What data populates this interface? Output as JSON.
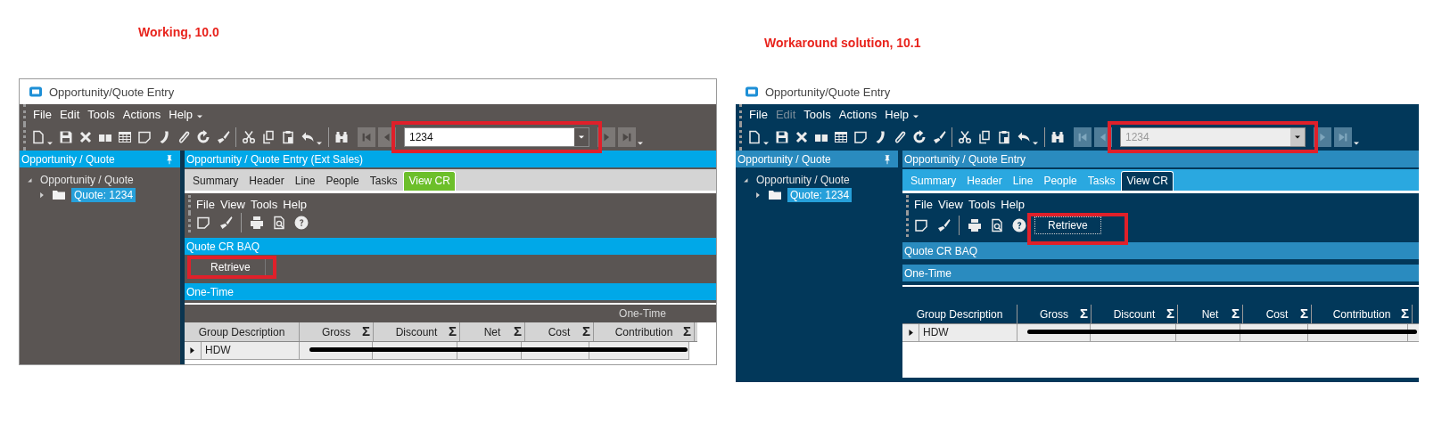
{
  "windows": [
    {
      "caption": "Working, 10.0",
      "kind": "dark",
      "title": "Opportunity/Quote Entry",
      "menu": [
        {
          "label": "File",
          "disabled": false
        },
        {
          "label": "Edit",
          "disabled": false
        },
        {
          "label": "Tools",
          "disabled": false
        },
        {
          "label": "Actions",
          "disabled": false
        },
        {
          "label": "Help",
          "disabled": false
        }
      ],
      "record": {
        "value": "1234",
        "disabled": false,
        "highlighted": true
      },
      "tree_panel": {
        "title": "Opportunity / Quote",
        "tree": [
          {
            "label": "Opportunity / Quote",
            "expanded": true,
            "selected": false,
            "children": [
              {
                "label": "Quote: 1234",
                "expanded": false,
                "selected": true
              }
            ]
          }
        ]
      },
      "detail_panel": {
        "title": "Opportunity / Quote Entry (Ext Sales)",
        "tabs": [
          {
            "label": "Summary",
            "selected": false
          },
          {
            "label": "Header",
            "selected": false
          },
          {
            "label": "Line",
            "selected": false
          },
          {
            "label": "People",
            "selected": false
          },
          {
            "label": "Tasks",
            "selected": false
          },
          {
            "label": "View CR",
            "selected": true
          }
        ],
        "menu": [
          "File",
          "View",
          "Tools",
          "Help"
        ],
        "blocks": [
          {
            "kind": "bar",
            "label": "Quote CR BAQ"
          },
          {
            "kind": "button_bar",
            "button": {
              "label": "Retrieve",
              "highlighted": true
            }
          },
          {
            "kind": "bar",
            "label": "One-Time"
          },
          {
            "kind": "band",
            "label": "One-Time"
          },
          {
            "kind": "grid",
            "columns": [
              {
                "label": "Group Description"
              },
              {
                "label": "Gross",
                "summary": "Σ"
              },
              {
                "label": "Discount",
                "summary": "Σ"
              },
              {
                "label": "Net",
                "summary": "Σ"
              },
              {
                "label": "Cost",
                "summary": "Σ"
              },
              {
                "label": "Contribution",
                "summary": "Σ"
              }
            ],
            "rows": [
              {
                "cells": [
                  "HDW"
                ],
                "redacted": true
              }
            ]
          }
        ]
      }
    },
    {
      "caption": "Workaround solution, 10.1",
      "kind": "navy",
      "title": "Opportunity/Quote Entry",
      "menu": [
        {
          "label": "File",
          "disabled": false
        },
        {
          "label": "Edit",
          "disabled": true
        },
        {
          "label": "Tools",
          "disabled": false
        },
        {
          "label": "Actions",
          "disabled": false
        },
        {
          "label": "Help",
          "disabled": false
        }
      ],
      "record": {
        "value": "1234",
        "disabled": true,
        "highlighted": true
      },
      "tree_panel": {
        "title": "Opportunity / Quote",
        "tree": [
          {
            "label": "Opportunity / Quote",
            "expanded": true,
            "selected": false,
            "children": [
              {
                "label": "Quote: 1234",
                "expanded": false,
                "selected": true
              }
            ]
          }
        ]
      },
      "detail_panel": {
        "title": "Opportunity / Quote Entry",
        "tabs": [
          {
            "label": "Summary",
            "selected": false
          },
          {
            "label": "Header",
            "selected": false
          },
          {
            "label": "Line",
            "selected": false
          },
          {
            "label": "People",
            "selected": false
          },
          {
            "label": "Tasks",
            "selected": false
          },
          {
            "label": "View CR",
            "selected": true
          }
        ],
        "menu": [
          "File",
          "View",
          "Tools",
          "Help"
        ],
        "toolbar_button": {
          "label": "Retrieve",
          "highlighted": true
        },
        "blocks": [
          {
            "kind": "bar",
            "label": "Quote CR BAQ"
          },
          {
            "kind": "bar",
            "label": "One-Time"
          },
          {
            "kind": "band"
          },
          {
            "kind": "grid",
            "columns": [
              {
                "label": "Group Description"
              },
              {
                "label": "Gross",
                "summary": "Σ"
              },
              {
                "label": "Discount",
                "summary": "Σ"
              },
              {
                "label": "Net",
                "summary": "Σ"
              },
              {
                "label": "Cost",
                "summary": "Σ"
              },
              {
                "label": "Contribution",
                "summary": "Σ"
              }
            ],
            "rows": [
              {
                "cells": [
                  "HDW"
                ],
                "redacted": true
              }
            ]
          },
          {
            "kind": "footer"
          }
        ]
      }
    }
  ]
}
